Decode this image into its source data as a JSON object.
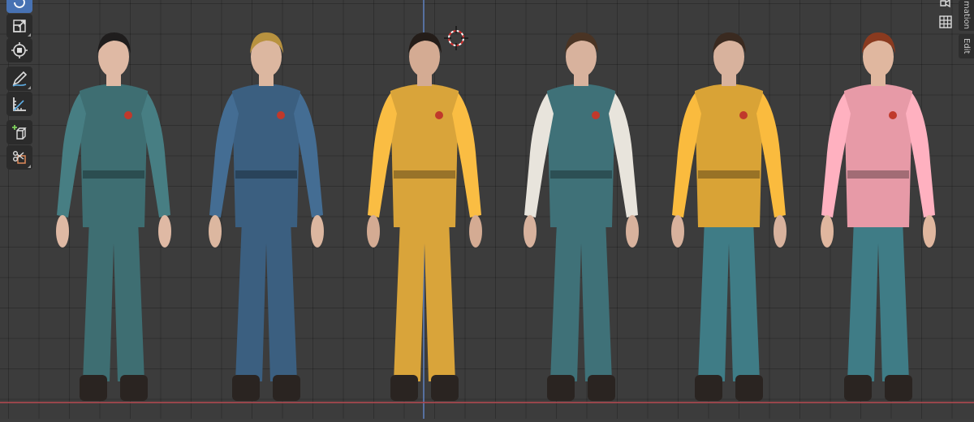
{
  "window": {
    "editor": "3D Viewport"
  },
  "toolbar": {
    "tools": [
      {
        "name": "rotate-tool",
        "icon": "rotate-icon",
        "active": true
      },
      {
        "name": "scale-tool",
        "icon": "scale-icon",
        "active": false
      },
      {
        "name": "transform-tool",
        "icon": "transform-icon",
        "active": false
      },
      {
        "name": "annotate-tool",
        "icon": "pencil-icon",
        "active": false
      },
      {
        "name": "measure-tool",
        "icon": "ruler-icon",
        "active": false
      },
      {
        "name": "add-cube-tool",
        "icon": "add-cube-icon",
        "active": false
      },
      {
        "name": "extrude-tool",
        "icon": "extrude-icon",
        "active": false
      }
    ]
  },
  "gizmo": {
    "buttons": [
      {
        "name": "camera-view-button",
        "icon": "camera-icon"
      },
      {
        "name": "toggle-grid-view-button",
        "icon": "grid-icon"
      }
    ]
  },
  "side_panel": {
    "tabs": [
      {
        "label": "mation"
      },
      {
        "label": "Edit"
      }
    ]
  },
  "scene": {
    "characters": [
      {
        "name": "character-teal-jumpsuit-woman",
        "outfit": "#3e6e72",
        "skin": "#dfb9a4",
        "hair": "#1f1d1d"
      },
      {
        "name": "character-blue-jumpsuit-blond",
        "outfit": "#3b5f80",
        "skin": "#dcb7a0",
        "hair": "#b8923f"
      },
      {
        "name": "character-yellow-jumpsuit",
        "outfit": "#d9a43a",
        "skin": "#d4ab93",
        "hair": "#241d19"
      },
      {
        "name": "character-teal-jumpsuit-white-sleeves",
        "outfit": "#3f7178",
        "skin": "#d8b29d",
        "hair": "#4a3424"
      },
      {
        "name": "character-yellow-polo-jeans",
        "outfit": "#d9a336",
        "skin": "#d8b29d",
        "hair": "#3a2a20"
      },
      {
        "name": "character-floral-shirt-jeans",
        "outfit": "#e79aa7",
        "skin": "#e0b79f",
        "hair": "#8a3a1f"
      }
    ]
  }
}
